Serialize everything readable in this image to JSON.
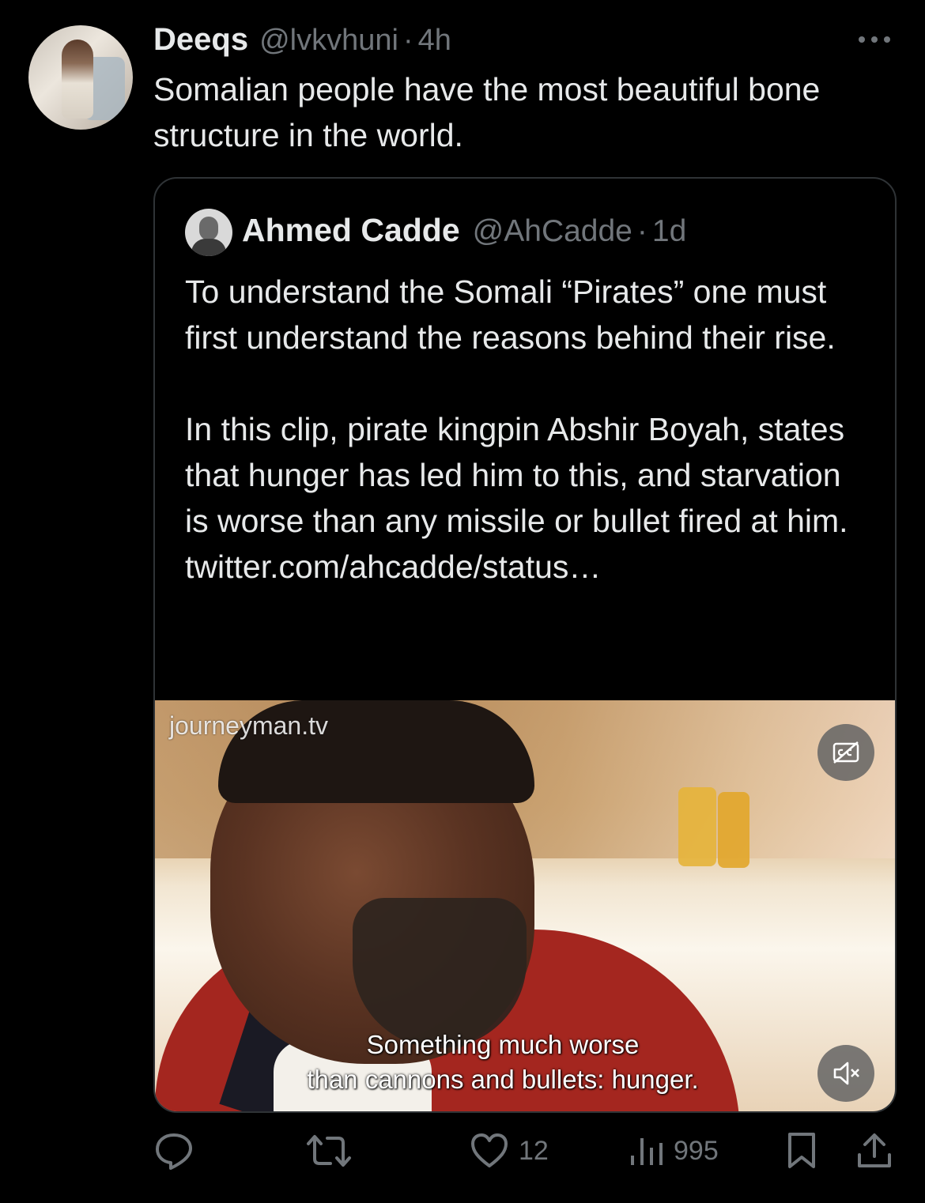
{
  "post": {
    "author_name": "Deeqs",
    "handle": "@lvkvhuni",
    "separator": "·",
    "time": "4h",
    "text": "Somalian people have the most beautiful bone structure in the world."
  },
  "quoted_post": {
    "author_name": "Ahmed Cadde",
    "handle": "@AhCadde",
    "separator": "·",
    "time": "1d",
    "text": "To understand the Somali “Pirates” one must first understand the reasons behind their rise.\n\nIn this clip, pirate kingpin Abshir Boyah, states that hunger has led him to this, and starvation is worse than any missile or bullet fired at him. twitter.com/ahcadde/status…",
    "video": {
      "watermark": "journeyman.tv",
      "caption_line1": "Something much worse",
      "caption_line2": "than cannons and bullets: hunger."
    }
  },
  "actions": {
    "reply_icon": "reply-icon",
    "retweet_icon": "retweet-icon",
    "like_icon": "heart-icon",
    "like_count": "12",
    "views_icon": "views-icon",
    "view_count": "995",
    "bookmark_icon": "bookmark-icon",
    "share_icon": "share-icon"
  },
  "colors": {
    "background": "#000000",
    "text": "#e7e9ea",
    "secondary": "#71767b",
    "border": "#2f3336"
  }
}
